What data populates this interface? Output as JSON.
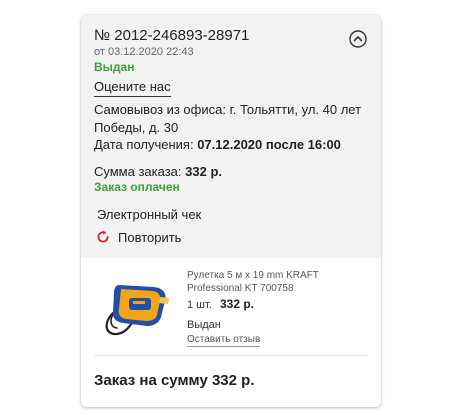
{
  "order": {
    "number": "№ 2012-246893-28971",
    "date": "от 03.12.2020 22:43",
    "status": "Выдан",
    "rate_label": "Оцените нас",
    "pickup": "Самовывоз из офиса: г. Тольятти, ул. 40 лет Победы, д. 30",
    "delivery_label": "Дата получения:",
    "delivery_value": "07.12.2020 после 16:00",
    "sum_label": "Сумма заказа:",
    "sum_value": "332 р.",
    "payment_status": "Заказ оплачен",
    "receipt_label": "Электронный чек",
    "repeat_label": "Повторить"
  },
  "item": {
    "name": "Рулетка 5 м х 19 mm KRAFT Professional KT 700758",
    "qty": "1 шт.",
    "price": "332 р.",
    "status": "Выдан",
    "review_label": "Оставить отзыв"
  },
  "total": "Заказ на сумму 332 р.",
  "colors": {
    "status_green": "#3aa335",
    "repeat_red": "#d9262c",
    "card_top_bg": "#f2f2f2"
  },
  "icons": {
    "collapse": "chevron-up-in-circle",
    "repeat": "circular-arrow"
  }
}
